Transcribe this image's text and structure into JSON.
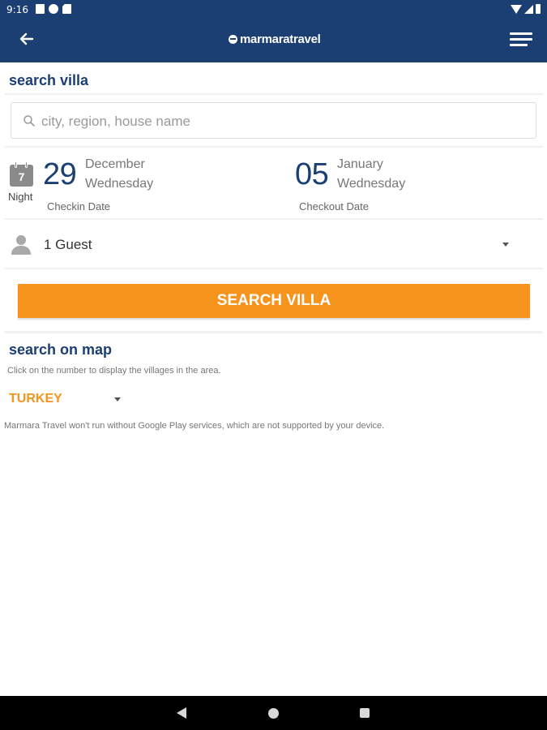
{
  "status_bar": {
    "time": "9:16"
  },
  "app_bar": {
    "brand": "marmaratravel",
    "back_icon": "arrow-left-icon",
    "menu_icon": "hamburger-menu-icon"
  },
  "search_villa": {
    "title": "search villa",
    "search_placeholder": "city, region, house name",
    "nights": {
      "count": "7",
      "label": "Night"
    },
    "checkin": {
      "day": "29",
      "month": "December",
      "weekday": "Wednesday",
      "caption": "Checkin Date"
    },
    "checkout": {
      "day": "05",
      "month": "January",
      "weekday": "Wednesday",
      "caption": "Checkout Date"
    },
    "guests": {
      "selected": "1 Guest"
    },
    "search_button": "SEARCH VILLA"
  },
  "search_map": {
    "title": "search on map",
    "hint": "Click on the number to display the villages in the area.",
    "country": "TURKEY",
    "notice": "Marmara Travel won't run without Google Play services, which are not supported by your device."
  },
  "colors": {
    "brand_navy": "#1b3f73",
    "accent_orange": "#f7941d"
  }
}
